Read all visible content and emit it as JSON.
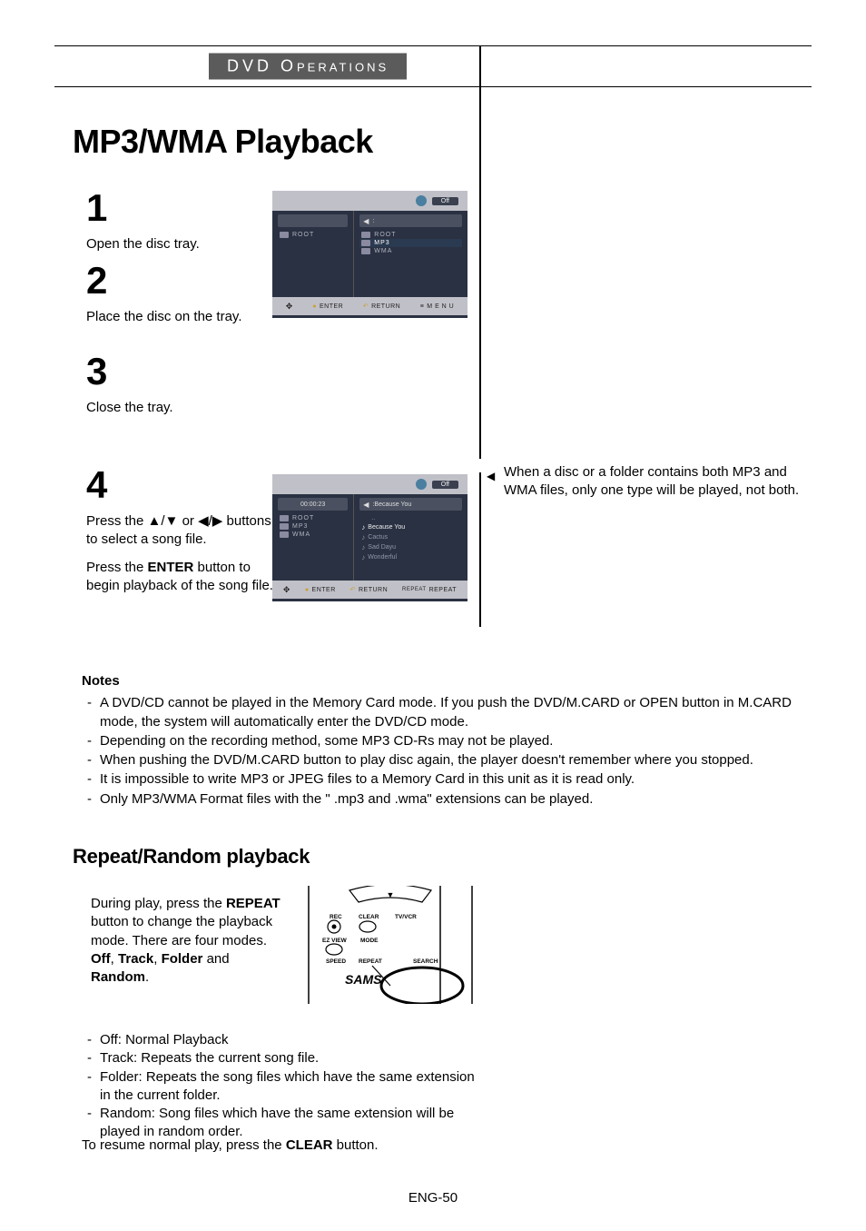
{
  "header": {
    "title_main": "DVD O",
    "title_rest": "PERATIONS"
  },
  "page_title": "MP3/WMA Playback",
  "steps": {
    "s1": {
      "num": "1",
      "text": "Open the disc tray."
    },
    "s2": {
      "num": "2",
      "text": "Place the disc on the tray."
    },
    "s3": {
      "num": "3",
      "text": "Close the tray."
    },
    "s4": {
      "num": "4",
      "text1_a": "Press the ",
      "text1_b": " or ",
      "text1_c": " buttons to select a song file.",
      "text2_a": "Press the ",
      "text2_bold": "ENTER",
      "text2_b": " button to begin playback of the song file."
    }
  },
  "screen1": {
    "off": "Off",
    "left_root": "ROOT",
    "right_items": [
      "ROOT",
      "MP3",
      "WMA"
    ],
    "bot_enter": "ENTER",
    "bot_return": "RETURN",
    "bot_menu": "M E N U"
  },
  "screen2": {
    "off": "Off",
    "timer": "00:00:23",
    "nowplaying": "Because You",
    "left_items": [
      "ROOT",
      "MP3",
      "WMA"
    ],
    "right_items": [
      "..",
      "Because You",
      "Cactus",
      "Sad Dayu",
      "Wonderful"
    ],
    "bot_enter": "ENTER",
    "bot_return": "RETURN",
    "bot_repeat": "REPEAT"
  },
  "sidenote": "When a disc or a folder contains both MP3 and WMA files, only one type will be played, not both.",
  "notes": {
    "title": "Notes",
    "items": [
      "A DVD/CD cannot be played in the Memory Card mode. If you push the DVD/M.CARD or OPEN button in M.CARD mode, the system will automatically enter the DVD/CD mode.",
      "Depending on the recording method, some MP3 CD-Rs may not be played.",
      "When pushing the DVD/M.CARD button to play disc again, the player doesn't remember where you stopped.",
      "It is impossible to write MP3 or JPEG files to a Memory Card in this unit as it is read only.",
      "Only MP3/WMA Format files with the \" .mp3 and .wma\" extensions can be played."
    ]
  },
  "repeat": {
    "title": "Repeat/Random playback",
    "para_a": "During play, press the ",
    "para_bold1": "REPEAT",
    "para_b": " button to change the playback mode. There are four modes.",
    "modes_line_a": "Off",
    "modes_line_b": ", ",
    "modes_line_c": "Track",
    "modes_line_d": ", ",
    "modes_line_e": "Folder",
    "modes_line_f": " and ",
    "modes_line_g": "Random",
    "modes_line_h": ".",
    "list": [
      "Off: Normal Playback",
      "Track: Repeats the current song file.",
      "Folder: Repeats the song files which have the same extension in the current folder.",
      "Random: Song files which have the same extension will be played in random order."
    ],
    "resume_a": "To resume normal play, press the ",
    "resume_bold": "CLEAR",
    "resume_b": " button."
  },
  "remote": {
    "rec": "REC",
    "clear": "CLEAR",
    "tvvcr": "TV/VCR",
    "ezview": "EZ VIEW",
    "mode": "MODE",
    "speed": "SPEED",
    "repeat": "REPEAT",
    "search": "SEARCH",
    "brand": "SAMS"
  },
  "page_number": "ENG-50"
}
